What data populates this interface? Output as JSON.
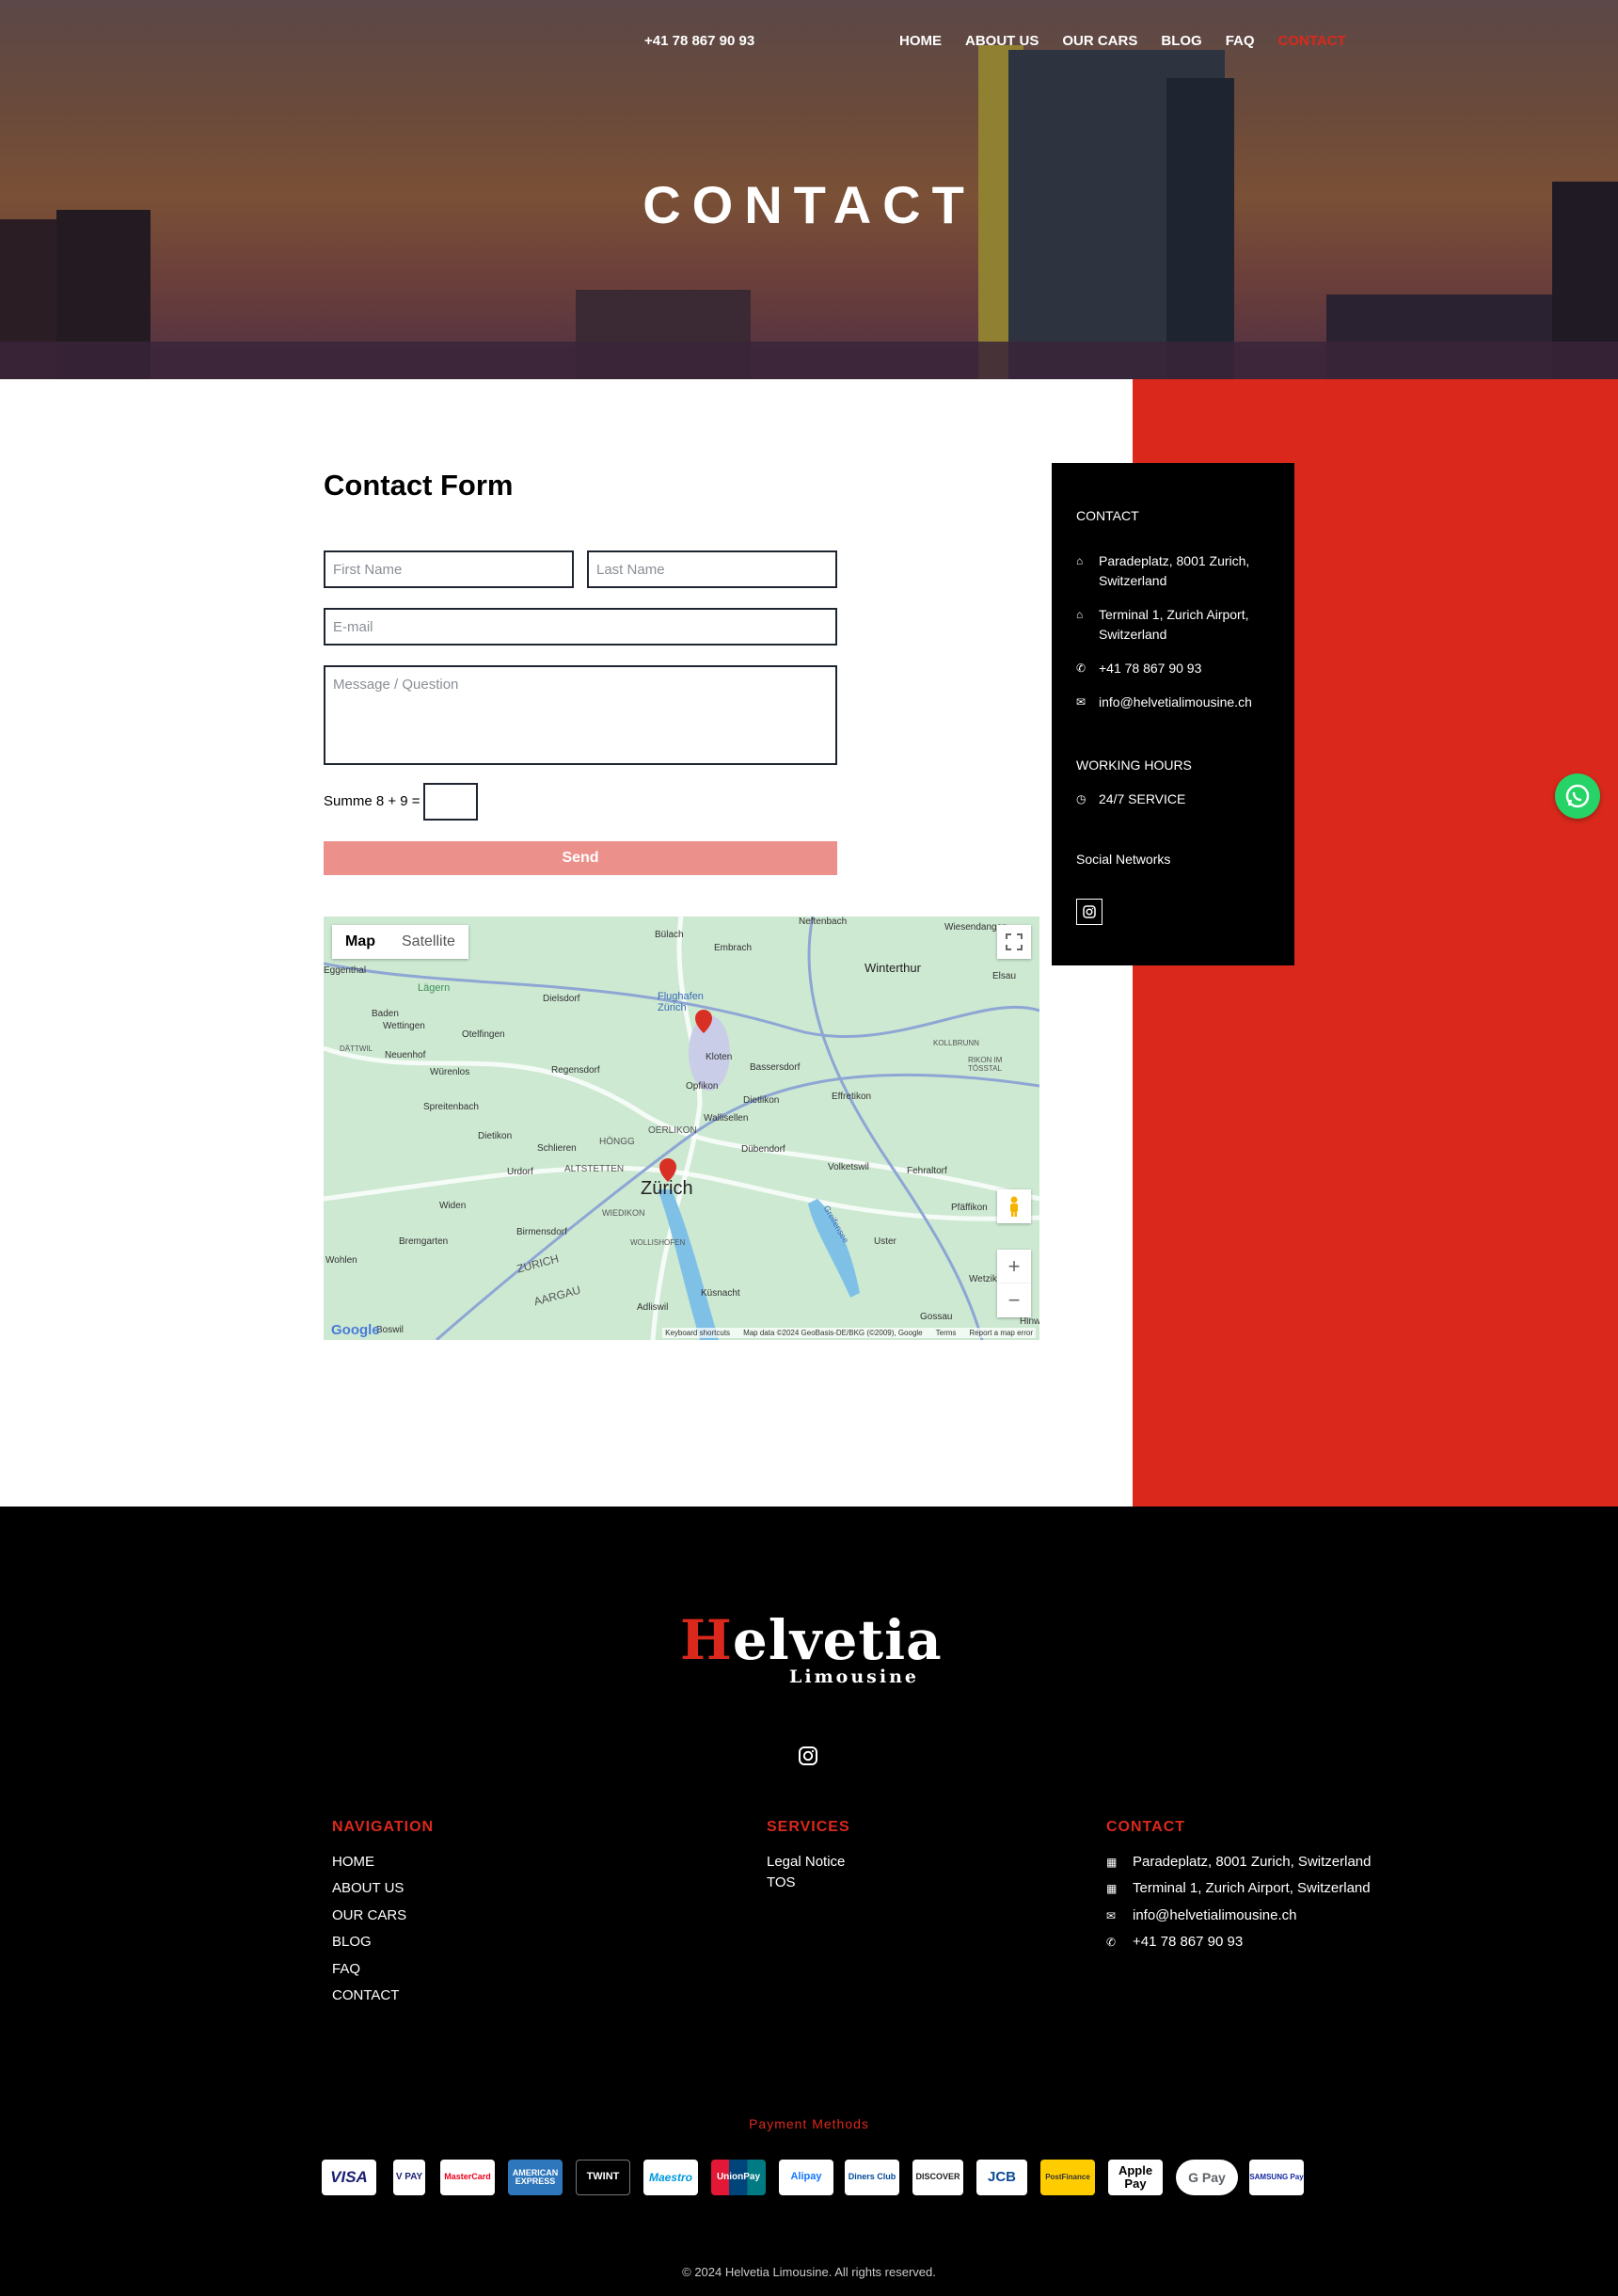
{
  "header": {
    "phone": "+41 78 867 90 93",
    "nav": [
      "HOME",
      "ABOUT US",
      "OUR CARS",
      "BLOG",
      "FAQ",
      "CONTACT"
    ],
    "active": "CONTACT",
    "title": "CONTACT"
  },
  "form": {
    "title": "Contact Form",
    "first_name_placeholder": "First Name",
    "last_name_placeholder": "Last Name",
    "email_placeholder": "E-mail",
    "message_placeholder": "Message / Question",
    "captcha_label": "Summe 8 + 9 =",
    "send_label": "Send"
  },
  "map": {
    "tab_map": "Map",
    "tab_satellite": "Satellite",
    "labels": [
      "Bülach",
      "Embrach",
      "Winterthur",
      "Baden",
      "Wettingen",
      "Dielsdorf",
      "Flughafen Zürich",
      "Kloten",
      "Otelfingen",
      "Lägern",
      "Würenlos",
      "Regensdorf",
      "Opfikon",
      "Bassersdorf",
      "Neuenhof",
      "Spreitenbach",
      "Wallisellen",
      "Dietlikon",
      "Effretikon",
      "Dietikon",
      "Schlieren",
      "HÖNGG",
      "OERLIKON",
      "Dübendorf",
      "ALTSTETTEN",
      "Urdorf",
      "Zürich",
      "Volketswil",
      "Fehraltorf",
      "WIEDIKON",
      "Widen",
      "Pfäffikon",
      "Birmensdorf",
      "Bremgarten",
      "Uster",
      "Wohlen",
      "ZURICH",
      "AARGAU",
      "Adliswil",
      "Küsnacht",
      "Greifensee",
      "Wetzikon",
      "Gossau",
      "Hinwil",
      "KOLLBRUNN",
      "Wiesendangen",
      "Neftenbach",
      "Elsau",
      "Eggenthal",
      "DÄTTWIL",
      "RIKON IM TÖSSTAL",
      "WOLLISHOFEN",
      "Boswil"
    ],
    "google": "Google",
    "attribution": [
      "Keyboard shortcuts",
      "Map data ©2024 GeoBasis-DE/BKG (©2009), Google",
      "Terms",
      "Report a map error"
    ],
    "zoom_in": "+",
    "zoom_out": "−"
  },
  "info": {
    "contact_heading": "CONTACT",
    "address1": "Paradeplatz, 8001 Zurich, Switzerland",
    "address2": "Terminal 1, Zurich Airport, Switzerland",
    "phone": "+41 78 867 90 93",
    "email": "info@helvetialimousine.ch",
    "hours_heading": "WORKING HOURS",
    "hours": "24/7 SERVICE",
    "social_heading": "Social Networks"
  },
  "footer": {
    "logo_main": "elvetia",
    "logo_initial": "H",
    "logo_sub": "Limousine",
    "nav_heading": "NAVIGATION",
    "nav": [
      "HOME",
      "ABOUT US",
      "OUR CARS",
      "BLOG",
      "FAQ",
      "CONTACT"
    ],
    "services_heading": "SERVICES",
    "services": [
      "Legal Notice",
      "TOS"
    ],
    "contact_heading": "CONTACT",
    "contact": [
      "Paradeplatz, 8001 Zurich, Switzerland",
      "Terminal 1, Zurich Airport, Switzerland",
      "info@helvetialimousine.ch",
      "+41 78 867 90 93"
    ],
    "payment_title": "Payment Methods",
    "payment_methods": [
      "VISA",
      "V PAY",
      "MasterCard",
      "AMERICAN EXPRESS",
      "TWINT",
      "Maestro",
      "UnionPay",
      "Alipay",
      "Diners Club",
      "DISCOVER",
      "JCB",
      "PostFinance",
      "Apple Pay",
      "G Pay",
      "SAMSUNG Pay"
    ],
    "copyright": "© 2024 Helvetia Limousine. All rights reserved."
  },
  "colors": {
    "accent": "#da291c",
    "send": "#ec908b",
    "whatsapp": "#25d366"
  }
}
